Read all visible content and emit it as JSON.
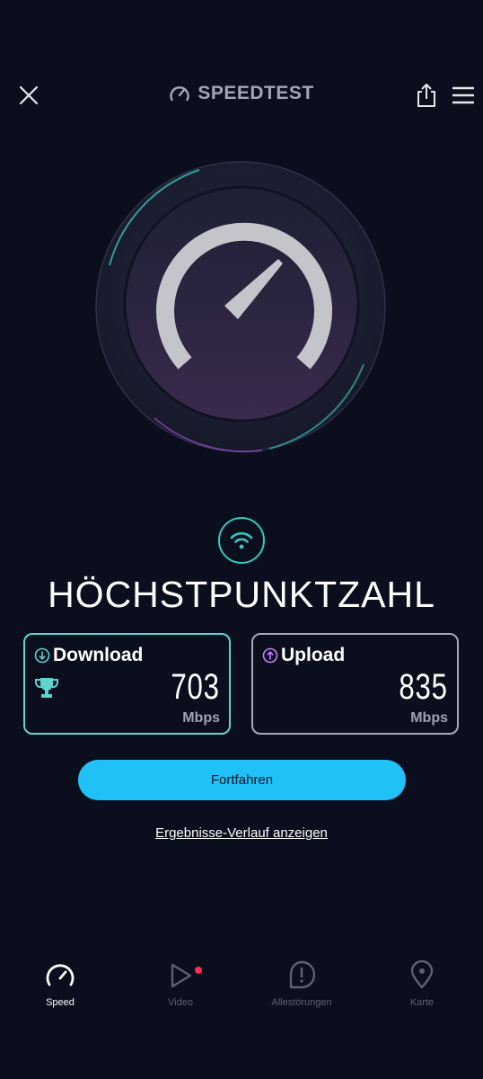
{
  "header": {
    "brand": "SPEEDTEST",
    "close_icon": "close-icon",
    "share_icon": "share-icon",
    "menu_icon": "hamburger-menu-icon"
  },
  "gauge": {
    "icon": "speedometer-gauge-icon"
  },
  "status": {
    "connection_icon": "wifi-icon",
    "headline": "HÖCHSTPUNKTZAHL"
  },
  "results": {
    "download": {
      "label": "Download",
      "value": "703",
      "unit": "Mbps",
      "icon": "download-arrow-icon",
      "badge_icon": "trophy-icon",
      "accent": "#5fd3d0"
    },
    "upload": {
      "label": "Upload",
      "value": "835",
      "unit": "Mbps",
      "icon": "upload-arrow-icon",
      "accent": "#c77dff"
    }
  },
  "actions": {
    "continue_label": "Fortfahren",
    "history_link": "Ergebnisse-Verlauf anzeigen"
  },
  "colors": {
    "background": "#0b0e1c",
    "primary_button": "#1fc1f7",
    "teal_accent": "#36c7c0"
  },
  "bottom_nav": {
    "items": [
      {
        "label": "Speed",
        "icon": "speed-gauge-icon",
        "active": true
      },
      {
        "label": "Video",
        "icon": "play-icon",
        "active": false,
        "has_notification": true
      },
      {
        "label": "Allestörungen",
        "icon": "alert-icon",
        "active": false
      },
      {
        "label": "Karte",
        "icon": "map-pin-icon",
        "active": false
      }
    ]
  }
}
